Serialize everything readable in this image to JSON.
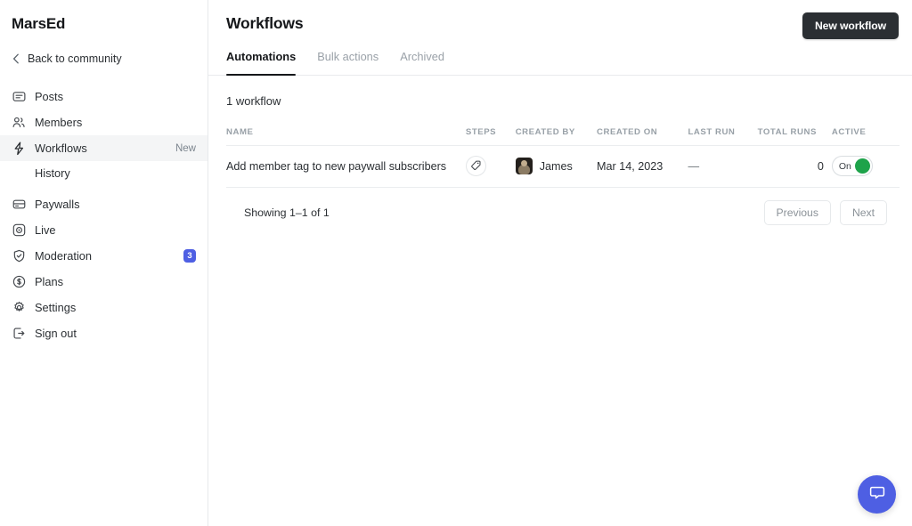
{
  "sidebar": {
    "brand": "MarsEd",
    "back_label": "Back to community",
    "back_icon": "chevron-left-icon",
    "items": [
      {
        "label": "Posts",
        "icon": "posts-icon",
        "badge": "",
        "tag": "",
        "active": false
      },
      {
        "label": "Members",
        "icon": "members-icon",
        "badge": "",
        "tag": "",
        "active": false
      },
      {
        "label": "Workflows",
        "icon": "lightning-icon",
        "badge": "",
        "tag": "New",
        "active": true
      },
      {
        "label": "Paywalls",
        "icon": "paywall-icon",
        "badge": "",
        "tag": "",
        "active": false
      },
      {
        "label": "Live",
        "icon": "live-icon",
        "badge": "",
        "tag": "",
        "active": false
      },
      {
        "label": "Moderation",
        "icon": "shield-icon",
        "badge": "3",
        "tag": "",
        "active": false
      },
      {
        "label": "Plans",
        "icon": "dollar-icon",
        "badge": "",
        "tag": "",
        "active": false
      },
      {
        "label": "Settings",
        "icon": "gear-icon",
        "badge": "",
        "tag": "",
        "active": false
      },
      {
        "label": "Sign out",
        "icon": "sign-out-icon",
        "badge": "",
        "tag": "",
        "active": false
      }
    ],
    "sub_item": {
      "label": "History",
      "parent": "Workflows"
    }
  },
  "header": {
    "title": "Workflows",
    "new_workflow_label": "New workflow"
  },
  "tabs": [
    {
      "label": "Automations",
      "active": true
    },
    {
      "label": "Bulk actions",
      "active": false
    },
    {
      "label": "Archived",
      "active": false
    }
  ],
  "summary": {
    "count_label": "1 workflow"
  },
  "table": {
    "columns": [
      "NAME",
      "STEPS",
      "CREATED BY",
      "CREATED ON",
      "LAST RUN",
      "TOTAL RUNS",
      "ACTIVE"
    ],
    "rows": [
      {
        "name": "Add member tag to new paywall subscribers",
        "steps_icon": "tag-icon",
        "created_by": "James",
        "created_by_avatar": "user-avatar",
        "created_on": "Mar 14, 2023",
        "last_run": "—",
        "total_runs": "0",
        "active_label": "On",
        "active_state": true
      }
    ]
  },
  "footer": {
    "showing": "Showing 1–1 of 1",
    "previous_label": "Previous",
    "next_label": "Next"
  },
  "chat": {
    "icon": "chat-bubble-icon"
  },
  "colors": {
    "accent_blue": "#4e5fe3",
    "toggle_green": "#1ea34a",
    "primary_dark": "#2b2f33",
    "muted_text": "#98a0a7",
    "border": "#e6e9eb"
  }
}
